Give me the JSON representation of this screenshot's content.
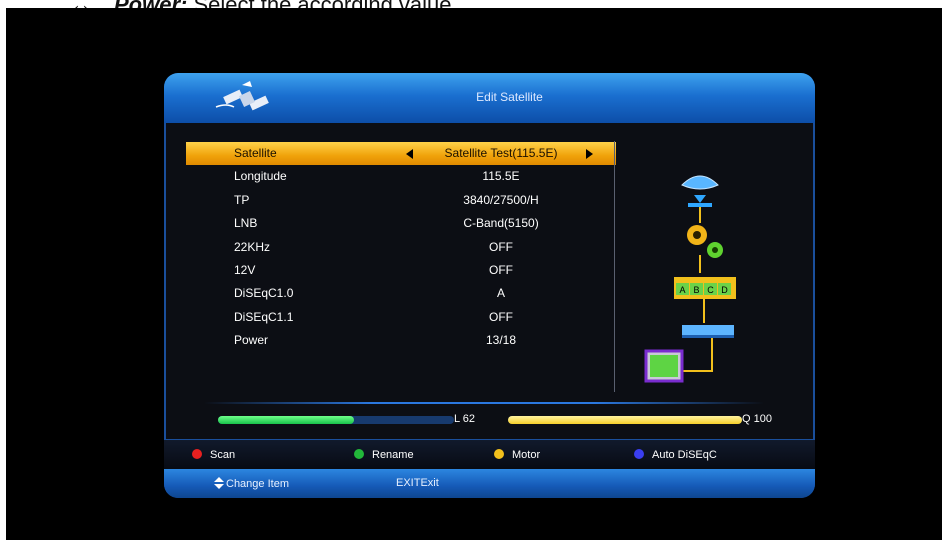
{
  "caption": {
    "arrow": "↔",
    "bold_text": "Power:",
    "rest_text": " Select the according value."
  },
  "title": "Edit Satellite",
  "rows": [
    {
      "label": "Satellite",
      "value": "Satellite Test(115.5E)",
      "selected": true
    },
    {
      "label": "Longitude",
      "value": "115.5E"
    },
    {
      "label": "TP",
      "value": "3840/27500/H"
    },
    {
      "label": "LNB",
      "value": "C-Band(5150)"
    },
    {
      "label": "22KHz",
      "value": "OFF"
    },
    {
      "label": "12V",
      "value": "OFF"
    },
    {
      "label": "DiSEqC1.0",
      "value": "A"
    },
    {
      "label": "DiSEqC1.1",
      "value": "OFF"
    },
    {
      "label": "Power",
      "value": "13/18"
    }
  ],
  "signal": {
    "level_label": "L  62",
    "level_value": 62,
    "quality_label": "Q 100",
    "quality_value": 100
  },
  "color_keys": [
    {
      "color": "#e82020",
      "label": "Scan",
      "name": "red"
    },
    {
      "color": "#22b83a",
      "label": "Rename",
      "name": "green"
    },
    {
      "color": "#f2c01c",
      "label": "Motor",
      "name": "yellow"
    },
    {
      "color": "#3a3ef0",
      "label": "Auto DiSEqC",
      "name": "blue"
    }
  ],
  "bottom_hints": {
    "change_item": "Change Item",
    "exit_key": "EXIT",
    "exit_label": "Exit"
  },
  "diagram_labels": [
    "A",
    "B",
    "C",
    "D"
  ],
  "icons": [
    "satellite-icon",
    "dish-icon",
    "gear-icon",
    "switch-icon",
    "receiver-icon",
    "tv-icon"
  ]
}
